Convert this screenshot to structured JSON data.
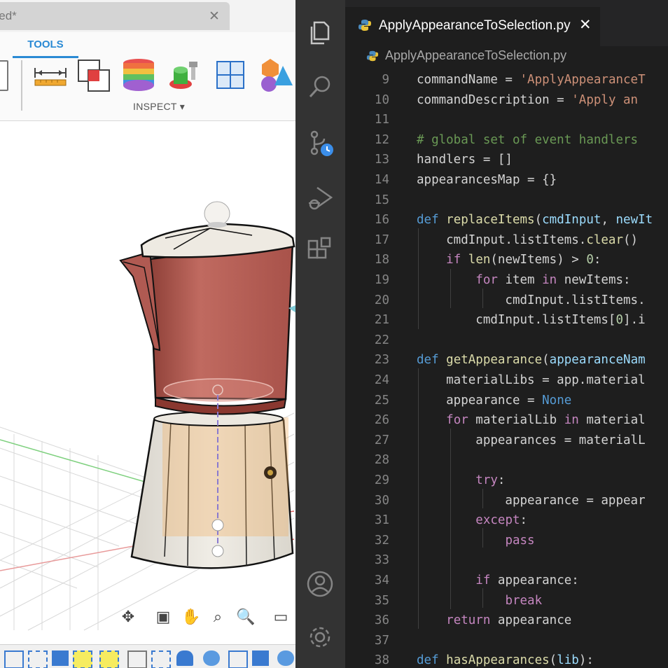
{
  "fusion": {
    "document_tab_title": "itled*",
    "close_glyph": "✕",
    "ribbon": {
      "active_tab": "TOOLS",
      "group_label": "INSPECT ▾",
      "icons": [
        "measure-icon",
        "interference-icon",
        "zebra-analysis-icon",
        "component-color-icon",
        "section-analysis-icon",
        "display-component-colors-icon"
      ]
    },
    "nav_icons": [
      "orbit-icon",
      "look-at-icon",
      "pan-icon",
      "zoom-icon",
      "fit-icon",
      "display-settings-icon"
    ]
  },
  "vscode": {
    "tab": {
      "label": "ApplyAppearanceToSelection.py",
      "close_glyph": "✕"
    },
    "breadcrumb": "ApplyAppearanceToSelection.py",
    "activity_icons": [
      "explorer-icon",
      "search-icon",
      "source-control-icon",
      "run-debug-icon",
      "extensions-icon",
      "accounts-icon",
      "manage-gear-icon"
    ],
    "code_lines": [
      {
        "n": "9",
        "text": "commandName = 'ApplyAppearanceT"
      },
      {
        "n": "10",
        "text": "commandDescription = 'Apply an "
      },
      {
        "n": "11",
        "text": ""
      },
      {
        "n": "12",
        "text": "# global set of event handlers "
      },
      {
        "n": "13",
        "text": "handlers = []"
      },
      {
        "n": "14",
        "text": "appearancesMap = {}"
      },
      {
        "n": "15",
        "text": ""
      },
      {
        "n": "16",
        "text": "def replaceItems(cmdInput, newIt"
      },
      {
        "n": "17",
        "text": "    cmdInput.listItems.clear()"
      },
      {
        "n": "18",
        "text": "    if len(newItems) > 0:"
      },
      {
        "n": "19",
        "text": "        for item in newItems:"
      },
      {
        "n": "20",
        "text": "            cmdInput.listItems."
      },
      {
        "n": "21",
        "text": "        cmdInput.listItems[0].i"
      },
      {
        "n": "22",
        "text": ""
      },
      {
        "n": "23",
        "text": "def getAppearance(appearanceNam"
      },
      {
        "n": "24",
        "text": "    materialLibs = app.material"
      },
      {
        "n": "25",
        "text": "    appearance = None"
      },
      {
        "n": "26",
        "text": "    for materialLib in material"
      },
      {
        "n": "27",
        "text": "        appearances = materialL"
      },
      {
        "n": "28",
        "text": ""
      },
      {
        "n": "29",
        "text": "        try:"
      },
      {
        "n": "30",
        "text": "            appearance = appear"
      },
      {
        "n": "31",
        "text": "        except:"
      },
      {
        "n": "32",
        "text": "            pass"
      },
      {
        "n": "33",
        "text": ""
      },
      {
        "n": "34",
        "text": "        if appearance:"
      },
      {
        "n": "35",
        "text": "            break"
      },
      {
        "n": "36",
        "text": "    return appearance"
      },
      {
        "n": "37",
        "text": ""
      },
      {
        "n": "38",
        "text": "def hasAppearances(lib):"
      }
    ]
  },
  "colors": {
    "accent_blue": "#2a8ad4",
    "editor_bg": "#1e1e1e",
    "activity_bar": "#333333",
    "pot_red": "#b05a52"
  }
}
